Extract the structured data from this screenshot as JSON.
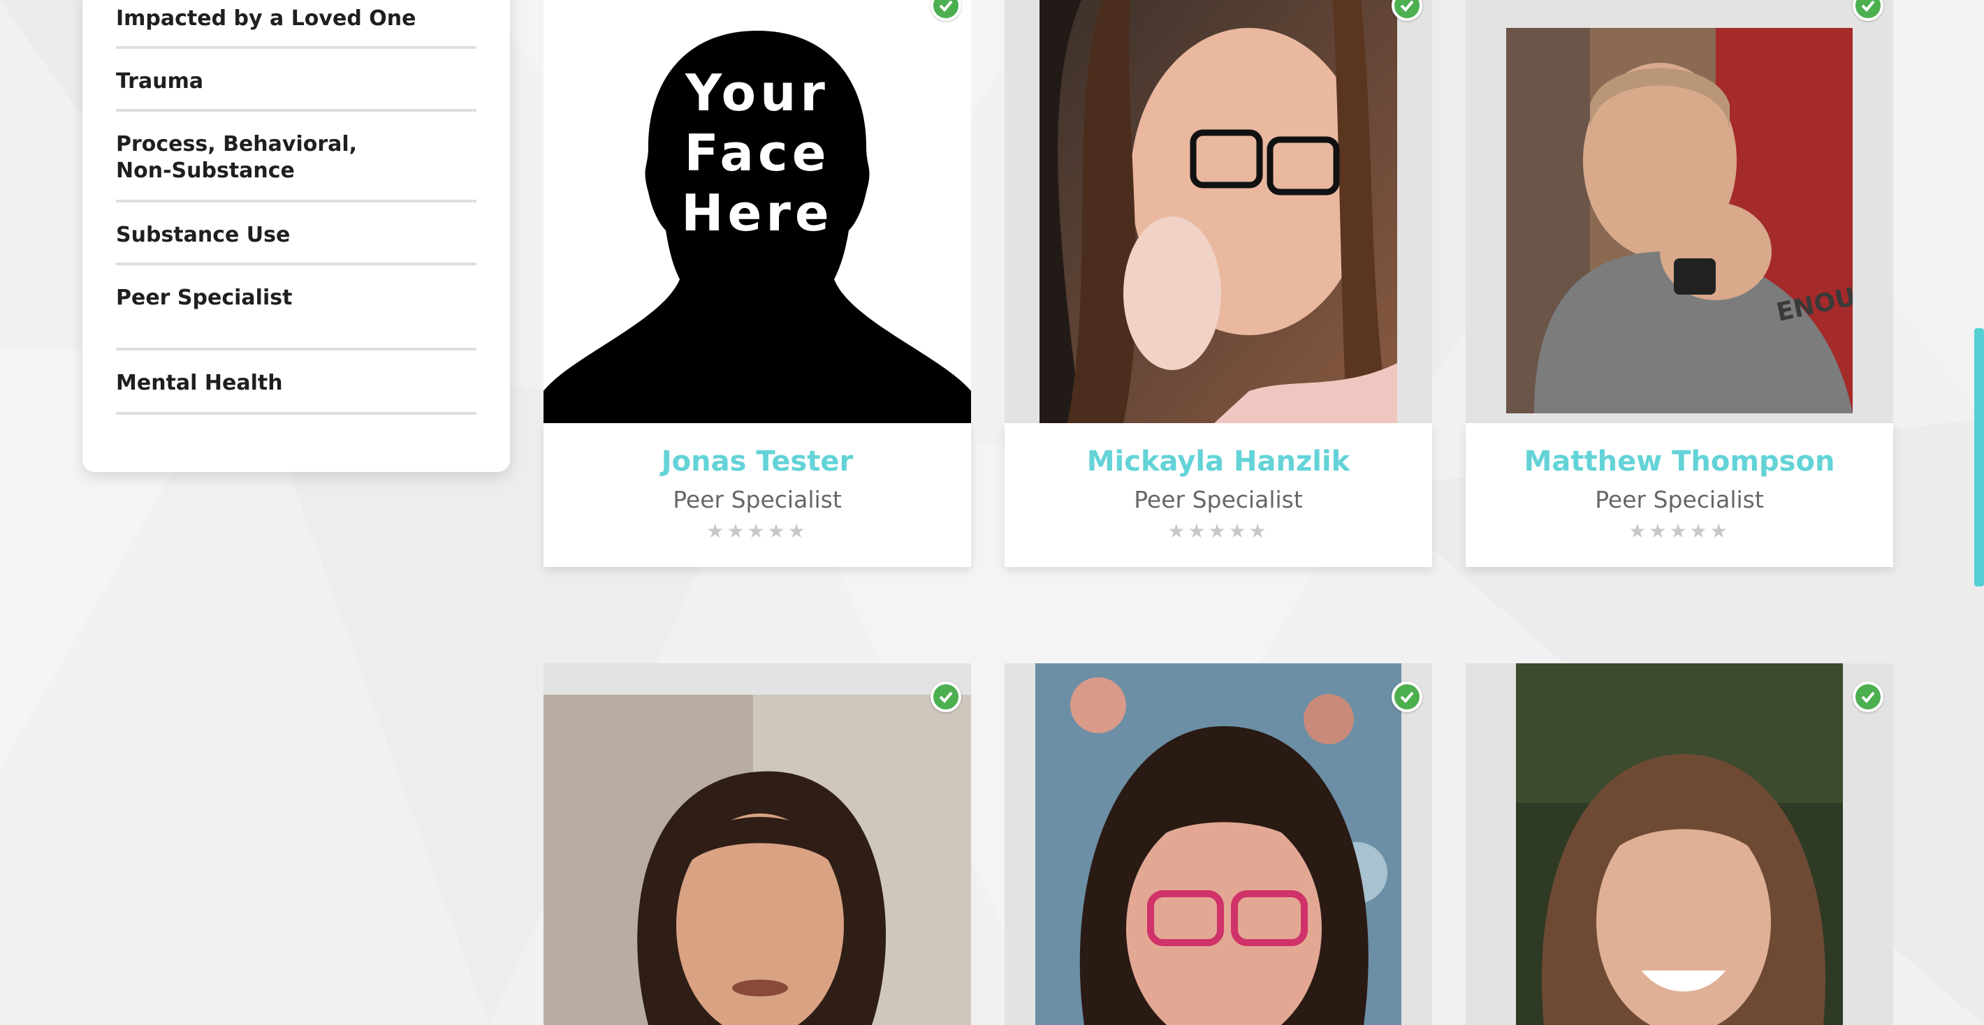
{
  "sidebar": {
    "items": [
      {
        "label": "Impacted by a Loved One"
      },
      {
        "label": "Trauma"
      },
      {
        "label": "Process, Behavioral, Non-Substance"
      },
      {
        "label": "Substance Use"
      },
      {
        "label": "Peer Specialist"
      },
      {
        "label": "Mental Health"
      }
    ]
  },
  "cards": [
    {
      "name": "Jonas Tester",
      "role": "Peer Specialist",
      "stars": "★★★★★",
      "rating": 0,
      "verified": true,
      "photo": "your-face-here",
      "placeholder": {
        "line1": "Your",
        "line2": "Face",
        "line3": "Here"
      }
    },
    {
      "name": "Mickayla Hanzlik",
      "role": "Peer Specialist",
      "stars": "★★★★★",
      "rating": 0,
      "verified": true,
      "photo": "woman-glasses-selfie"
    },
    {
      "name": "Matthew Thompson",
      "role": "Peer Specialist",
      "stars": "★★★★★",
      "rating": 0,
      "verified": true,
      "photo": "man-you-are-enough-shirt"
    },
    {
      "verified": true,
      "photo": "woman-curly-hair"
    },
    {
      "verified": true,
      "photo": "woman-pink-glasses"
    },
    {
      "verified": true,
      "photo": "woman-smiling-outdoors"
    }
  ],
  "colors": {
    "accent": "#63d3d7",
    "verified": "#4caf50",
    "background": "#f1f1f1"
  }
}
